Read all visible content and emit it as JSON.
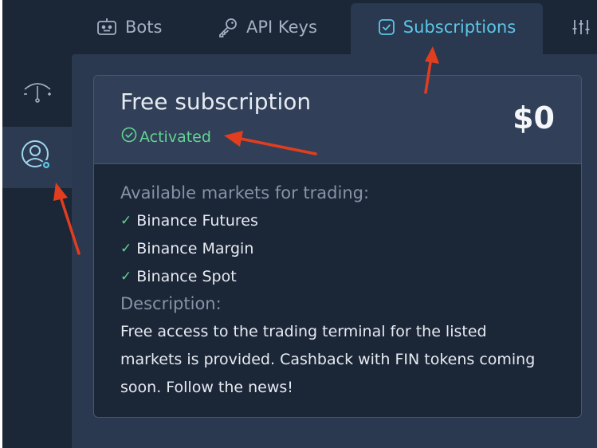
{
  "tabs": [
    {
      "label": "Bots",
      "icon": "robot-icon"
    },
    {
      "label": "API Keys",
      "icon": "key-icon"
    },
    {
      "label": "Subscriptions",
      "icon": "checkbox-icon",
      "active": true
    },
    {
      "label": "",
      "icon": "sliders-icon"
    }
  ],
  "rail": [
    {
      "icon": "parachute-icon"
    },
    {
      "icon": "user-settings-icon",
      "active": true
    }
  ],
  "subscription": {
    "title": "Free subscription",
    "status": "Activated",
    "price": "$0",
    "markets_label": "Available markets for trading:",
    "markets": [
      "Binance Futures",
      "Binance Margin",
      "Binance Spot"
    ],
    "check_glyph": "✓",
    "description_label": "Description:",
    "description": "Free access to the trading terminal for the listed markets is provided. Cashback with FIN tokens coming soon. Follow the news!"
  },
  "colors": {
    "background": "#1b2637",
    "panel": "#2a3850",
    "accent": "#5cc7e6",
    "success": "#62d492",
    "annotation_arrow": "#e23d1f"
  }
}
